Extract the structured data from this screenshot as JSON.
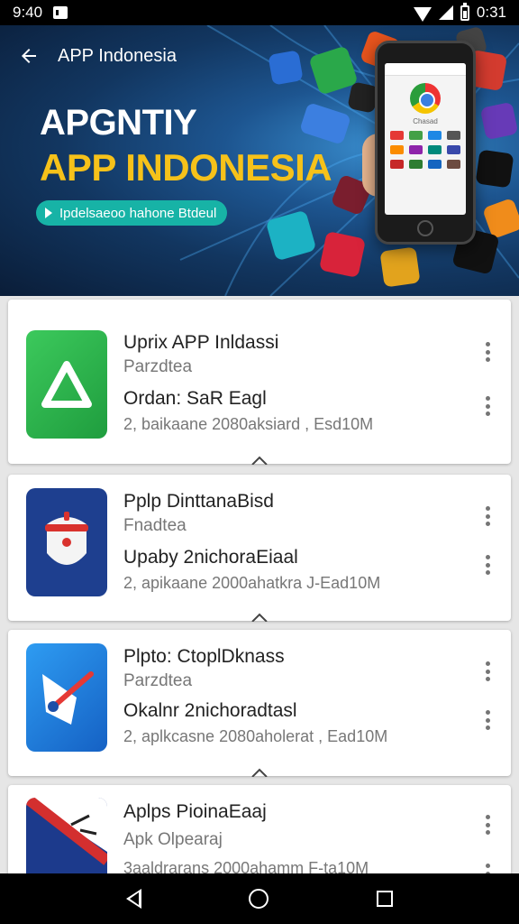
{
  "status_bar": {
    "time_left": "9:40",
    "time_right": "0:31"
  },
  "header": {
    "title": "APP Indonesia",
    "headline_line1": "APGNTIY",
    "headline_line2": "APP INDONESIA",
    "pill_text": "Ipdelsaeoo hahone Btdeul",
    "phone_screen_search": "Chasad"
  },
  "apps": [
    {
      "title": "Uprix APP Inldassi",
      "category": "Parzdtea",
      "subtitle": "Ordan: SaR Eagl",
      "meta": "2, baikaane 2080aksiard , Esd10M",
      "icon": "triangle-logo-icon",
      "icon_color": "#2bb24c"
    },
    {
      "title": "Pplp DinttanaBisd",
      "category": "Fnadtea",
      "subtitle": "Upaby 2nichoraEiaal",
      "meta": "2, apikaane 2000ahatkra J-Ead10M",
      "icon": "robot-mascot-icon",
      "icon_color": "#1e3f8f"
    },
    {
      "title": "Plpto: CtoplDknass",
      "category": "Parzdtea",
      "subtitle": "Okalnr 2nichoradtasl",
      "meta": "2, aplkcasne 2080aholerat , Ead10M",
      "icon": "swoosh-shield-icon",
      "icon_color": "#1f7fd9"
    },
    {
      "title": "Aplps PioinaEaaj",
      "category": "Apk  Olpearaj",
      "subtitle": "",
      "meta": "3aaldrarans 2000ahamm F-ta10M",
      "icon": "stripe-flag-icon",
      "icon_color": "#1c3a8c"
    }
  ],
  "nav_bar": {
    "back": "back-icon",
    "home": "home-icon",
    "recents": "recents-icon"
  },
  "colors": {
    "accent_yellow": "#f6c21a",
    "accent_teal": "#17b3a6",
    "banner_dark": "#0a1d38"
  }
}
